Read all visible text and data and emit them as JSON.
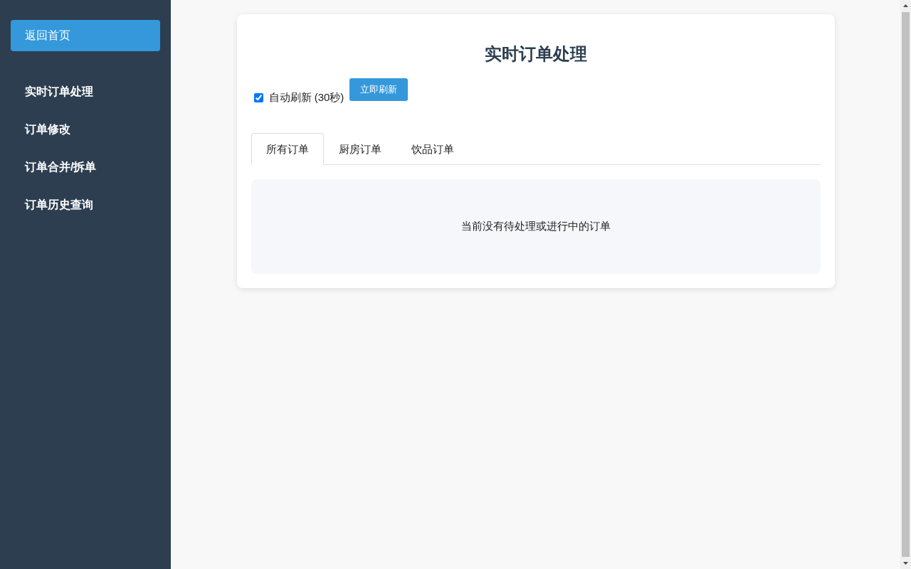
{
  "sidebar": {
    "home_button": "返回首页",
    "items": [
      {
        "label": "实时订单处理"
      },
      {
        "label": "订单修改"
      },
      {
        "label": "订单合并/拆单"
      },
      {
        "label": "订单历史查询"
      }
    ]
  },
  "main": {
    "title": "实时订单处理",
    "auto_refresh": {
      "label": "自动刷新 (30秒)",
      "checked": true
    },
    "refresh_button": "立即刷新",
    "tabs": [
      {
        "label": "所有订单",
        "selected": true
      },
      {
        "label": "厨房订单",
        "selected": false
      },
      {
        "label": "饮品订单",
        "selected": false
      }
    ],
    "empty_message": "当前没有待处理或进行中的订单"
  }
}
